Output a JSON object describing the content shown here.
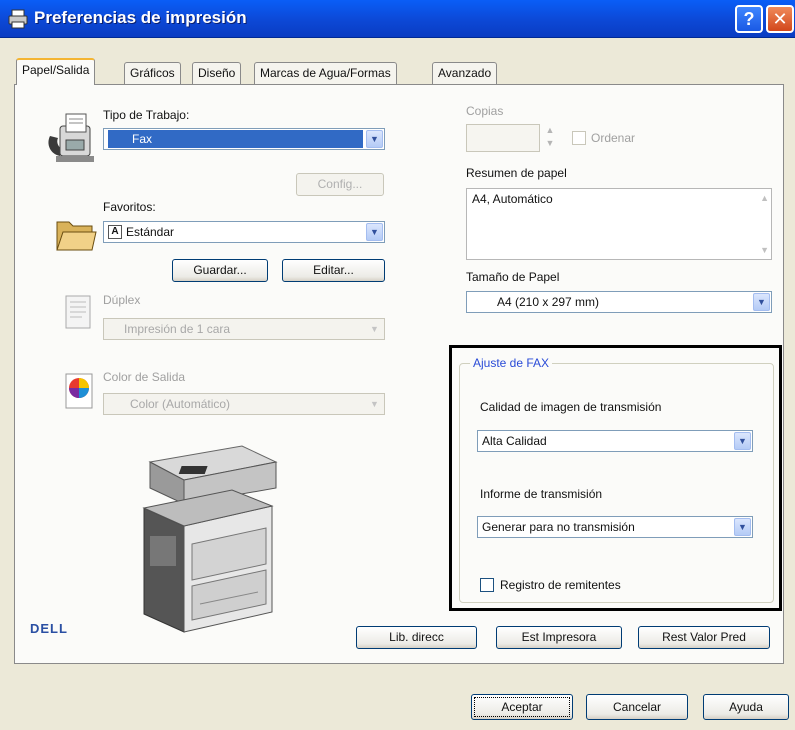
{
  "window": {
    "title": "Preferencias de impresión",
    "help_glyph": "?",
    "close_glyph": "✕"
  },
  "tabs": [
    {
      "label": "Papel/Salida",
      "active": true
    },
    {
      "label": "Gráficos"
    },
    {
      "label": "Diseño"
    },
    {
      "label": "Marcas de Agua/Formas"
    },
    {
      "label": "Avanzado"
    }
  ],
  "job_type": {
    "label": "Tipo de Trabajo:",
    "value": "Fax",
    "setup_button": "Config..."
  },
  "favorites": {
    "label": "Favoritos:",
    "value": "Estándar",
    "save_button": "Guardar...",
    "edit_button": "Editar..."
  },
  "duplex": {
    "label": "Dúplex",
    "value": "Impresión de 1 cara"
  },
  "output_color": {
    "label": "Color de Salida",
    "value": "Color (Automático)"
  },
  "copies": {
    "label": "Copias",
    "value": "",
    "collate_label": "Ordenar"
  },
  "paper_summary": {
    "label": "Resumen de papel",
    "value": "A4, Automático"
  },
  "paper_size": {
    "label": "Tamaño de Papel",
    "value": "A4 (210 x 297 mm)"
  },
  "fax_settings": {
    "group_title": "Ajuste de FAX",
    "quality_label": "Calidad de imagen de transmisión",
    "quality_value": "Alta Calidad",
    "report_label": "Informe de transmisión",
    "report_value": "Generar para no transmisión",
    "sender_log_label": "Registro de remitentes",
    "sender_log_checked": false
  },
  "bottom_buttons": {
    "address_book": "Lib. direcc",
    "printer_status": "Est Impresora",
    "restore_defaults": "Rest Valor Pred"
  },
  "brand": "DELL",
  "dialog_buttons": {
    "accept": "Aceptar",
    "cancel": "Cancelar",
    "help": "Ayuda"
  },
  "colors": {
    "titlebar": "#0c48d6",
    "selection": "#316ac5",
    "group_title": "#2a4bd7"
  }
}
